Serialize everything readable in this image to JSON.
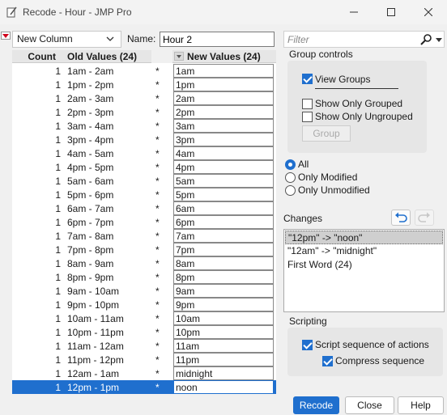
{
  "window": {
    "title": "Recode - Hour - JMP Pro"
  },
  "toolbar": {
    "target_dropdown": "New Column",
    "name_label": "Name:",
    "name_value": "Hour 2"
  },
  "grid": {
    "headers": {
      "count": "Count",
      "old": "Old Values (24)",
      "new": "New Values (24)"
    },
    "rows": [
      {
        "count": "1",
        "old": "1am - 2am",
        "star": "*",
        "new": "1am"
      },
      {
        "count": "1",
        "old": "1pm - 2pm",
        "star": "*",
        "new": "1pm"
      },
      {
        "count": "1",
        "old": "2am - 3am",
        "star": "*",
        "new": "2am"
      },
      {
        "count": "1",
        "old": "2pm - 3pm",
        "star": "*",
        "new": "2pm"
      },
      {
        "count": "1",
        "old": "3am - 4am",
        "star": "*",
        "new": "3am"
      },
      {
        "count": "1",
        "old": "3pm - 4pm",
        "star": "*",
        "new": "3pm"
      },
      {
        "count": "1",
        "old": "4am - 5am",
        "star": "*",
        "new": "4am"
      },
      {
        "count": "1",
        "old": "4pm - 5pm",
        "star": "*",
        "new": "4pm"
      },
      {
        "count": "1",
        "old": "5am - 6am",
        "star": "*",
        "new": "5am"
      },
      {
        "count": "1",
        "old": "5pm - 6pm",
        "star": "*",
        "new": "5pm"
      },
      {
        "count": "1",
        "old": "6am - 7am",
        "star": "*",
        "new": "6am"
      },
      {
        "count": "1",
        "old": "6pm - 7pm",
        "star": "*",
        "new": "6pm"
      },
      {
        "count": "1",
        "old": "7am - 8am",
        "star": "*",
        "new": "7am"
      },
      {
        "count": "1",
        "old": "7pm - 8pm",
        "star": "*",
        "new": "7pm"
      },
      {
        "count": "1",
        "old": "8am - 9am",
        "star": "*",
        "new": "8am"
      },
      {
        "count": "1",
        "old": "8pm - 9pm",
        "star": "*",
        "new": "8pm"
      },
      {
        "count": "1",
        "old": "9am - 10am",
        "star": "*",
        "new": "9am"
      },
      {
        "count": "1",
        "old": "9pm - 10pm",
        "star": "*",
        "new": "9pm"
      },
      {
        "count": "1",
        "old": "10am - 11am",
        "star": "*",
        "new": "10am"
      },
      {
        "count": "1",
        "old": "10pm - 11pm",
        "star": "*",
        "new": "10pm"
      },
      {
        "count": "1",
        "old": "11am - 12am",
        "star": "*",
        "new": "11am"
      },
      {
        "count": "1",
        "old": "11pm - 12pm",
        "star": "*",
        "new": "11pm"
      },
      {
        "count": "1",
        "old": "12am - 1am",
        "star": "*",
        "new": "midnight"
      },
      {
        "count": "1",
        "old": "12pm - 1pm",
        "star": "*",
        "new": "noon",
        "selected": true
      }
    ]
  },
  "filter": {
    "placeholder": "Filter"
  },
  "group_controls": {
    "title": "Group controls",
    "view_groups": "View Groups",
    "only_grouped": "Show Only Grouped",
    "only_ungrouped": "Show Only Ungrouped",
    "group_button": "Group"
  },
  "radio": {
    "all": "All",
    "modified": "Only Modified",
    "unmodified": "Only Unmodified"
  },
  "changes": {
    "title": "Changes",
    "items": [
      "\"12pm\" -> \"noon\"",
      "\"12am\" -> \"midnight\"",
      "First Word (24)"
    ]
  },
  "scripting": {
    "title": "Scripting",
    "script_sequence": "Script sequence of actions",
    "compress": "Compress sequence"
  },
  "buttons": {
    "recode": "Recode",
    "close": "Close",
    "help": "Help"
  },
  "colors": {
    "accent": "#1f6fce"
  }
}
